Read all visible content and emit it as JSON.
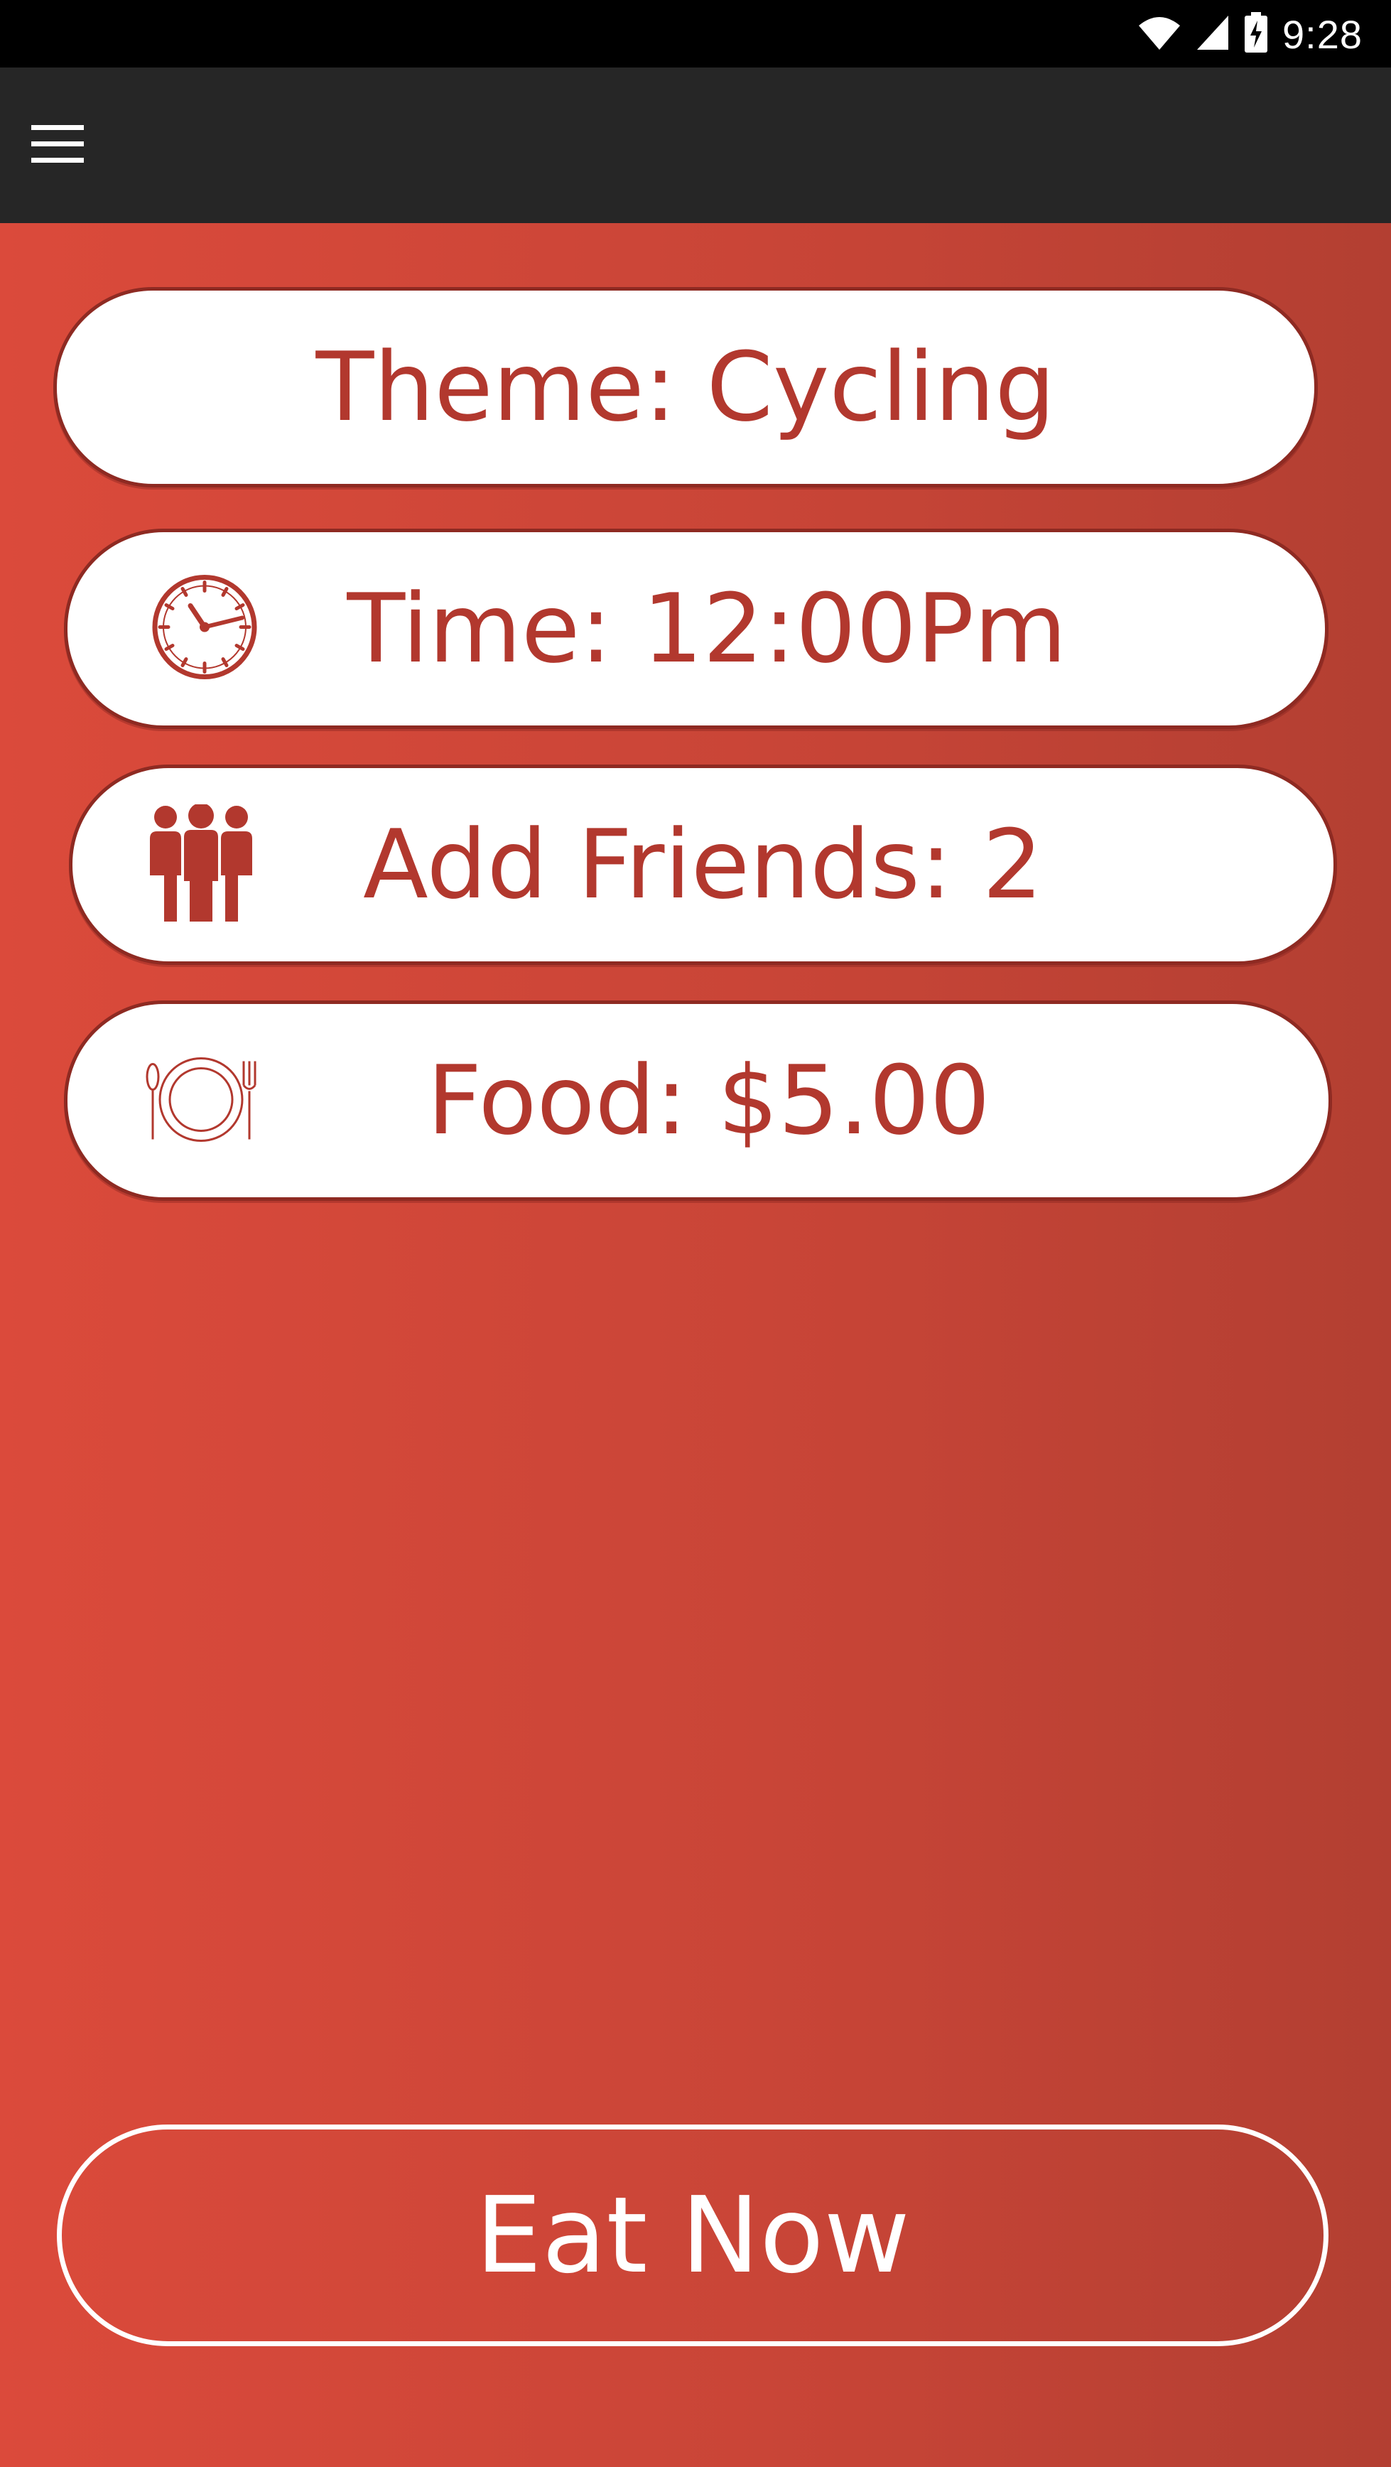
{
  "status_bar": {
    "time": "9:28",
    "icons": [
      "wifi-icon",
      "signal-icon",
      "battery-charging-icon"
    ]
  },
  "app_bar": {
    "menu_icon": "hamburger-menu-icon"
  },
  "options": {
    "theme": {
      "label": "Theme: Cycling"
    },
    "time": {
      "label": "Time: 12:00Pm",
      "icon": "clock-icon"
    },
    "friends": {
      "label": "Add Friends: 2",
      "icon": "people-icon"
    },
    "food": {
      "label": "Food: $5.00",
      "icon": "plate-cutlery-icon"
    }
  },
  "actions": {
    "eat_now_label": "Eat Now"
  },
  "colors": {
    "accent": "#b2382e",
    "background_gradient_start": "#db4a3b",
    "background_gradient_end": "#b33f32",
    "app_bar": "#262626",
    "status_bar": "#000000"
  }
}
